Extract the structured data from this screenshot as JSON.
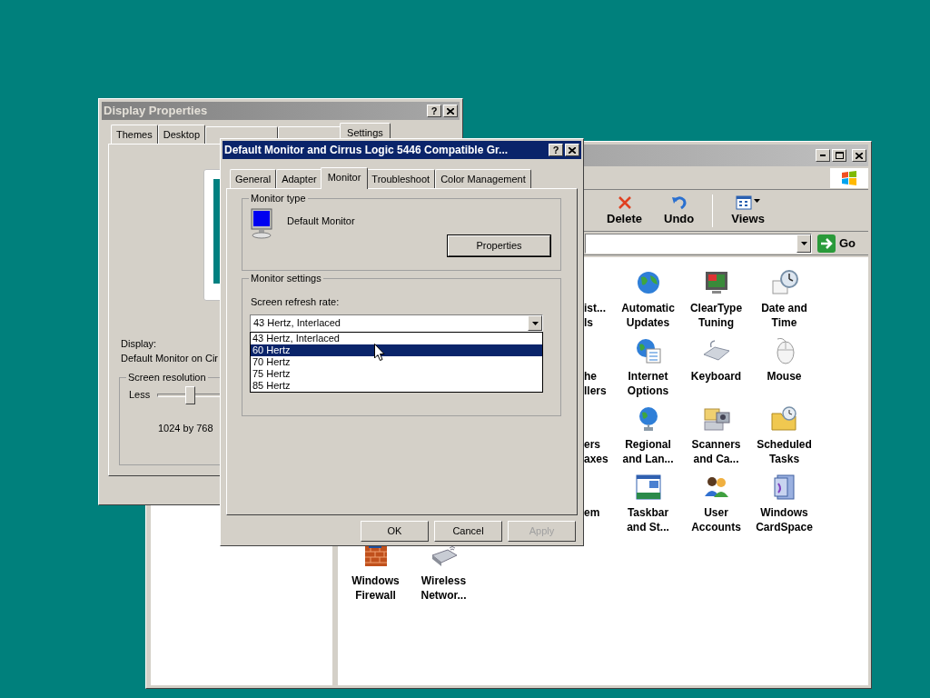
{
  "display_properties": {
    "title": "Display Properties",
    "help": "?",
    "tabs": [
      {
        "label": "Themes",
        "selected": false
      },
      {
        "label": "Desktop",
        "selected": false
      },
      {
        "label": "Settings",
        "selected": true
      }
    ],
    "display_label": "Display:",
    "display_value": "Default Monitor on Cir",
    "resolution": {
      "legend": "Screen resolution",
      "min_label": "Less",
      "level": 0.22,
      "reading": "1024 by 768"
    }
  },
  "control_panel": {
    "toolbar": [
      {
        "label": "Delete",
        "kind": "button"
      },
      {
        "label": "Undo",
        "kind": "button"
      },
      {
        "label": "Views",
        "kind": "dropdown"
      }
    ],
    "go_label": "Go",
    "icon_rows": [
      {
        "items": [
          {
            "kind": "partial",
            "lines": [
              "ist...",
              "ls"
            ]
          },
          {
            "kind": "full",
            "lines": [
              "Automatic",
              "Updates"
            ]
          },
          {
            "kind": "full",
            "lines": [
              "ClearType",
              "Tuning"
            ]
          },
          {
            "kind": "full",
            "lines": [
              "Date and",
              "Time"
            ]
          }
        ]
      },
      {
        "items": [
          {
            "kind": "partial",
            "lines": [
              "he",
              "llers"
            ]
          },
          {
            "kind": "full",
            "lines": [
              "Internet",
              "Options"
            ]
          },
          {
            "kind": "full",
            "lines": [
              "Keyboard"
            ]
          },
          {
            "kind": "full",
            "lines": [
              "Mouse"
            ]
          }
        ]
      },
      {
        "items": [
          {
            "kind": "partial",
            "lines": [
              "ers",
              "axes"
            ]
          },
          {
            "kind": "full",
            "lines": [
              "Regional",
              "and Lan..."
            ]
          },
          {
            "kind": "full",
            "lines": [
              "Scanners",
              "and Ca..."
            ]
          },
          {
            "kind": "full",
            "lines": [
              "Scheduled",
              "Tasks"
            ]
          }
        ]
      },
      {
        "items": [
          {
            "kind": "partial",
            "lines": [
              "em"
            ]
          },
          {
            "kind": "full",
            "lines": [
              "Taskbar",
              "and St..."
            ]
          },
          {
            "kind": "full",
            "lines": [
              "User",
              "Accounts"
            ]
          },
          {
            "kind": "full",
            "lines": [
              "Windows",
              "CardSpace"
            ]
          }
        ]
      },
      {
        "items": [
          {
            "kind": "full",
            "lines": [
              "Windows",
              "Firewall"
            ]
          },
          {
            "kind": "full",
            "lines": [
              "Wireless",
              "Networ..."
            ]
          }
        ]
      }
    ]
  },
  "monitor_dialog": {
    "title": "Default Monitor and Cirrus Logic 5446 Compatible Gr...",
    "help": "?",
    "tabs": [
      {
        "label": "General",
        "selected": false
      },
      {
        "label": "Adapter",
        "selected": false
      },
      {
        "label": "Monitor",
        "selected": true
      },
      {
        "label": "Troubleshoot",
        "selected": false
      },
      {
        "label": "Color Management",
        "selected": false
      }
    ],
    "monitor_type": {
      "legend": "Monitor type",
      "name": "Default Monitor",
      "button": "Properties"
    },
    "monitor_settings": {
      "legend": "Monitor settings",
      "refresh_label": "Screen refresh rate:",
      "refresh_value": "43 Hertz, Interlaced",
      "options": [
        {
          "label": "43 Hertz, Interlaced",
          "selected": false
        },
        {
          "label": "60 Hertz",
          "selected": true
        },
        {
          "label": "70 Hertz",
          "selected": false
        },
        {
          "label": "75 Hertz",
          "selected": false
        },
        {
          "label": "85 Hertz",
          "selected": false
        }
      ]
    },
    "buttons": [
      {
        "label": "OK",
        "disabled": false
      },
      {
        "label": "Cancel",
        "disabled": false
      },
      {
        "label": "Apply",
        "disabled": true
      }
    ]
  }
}
